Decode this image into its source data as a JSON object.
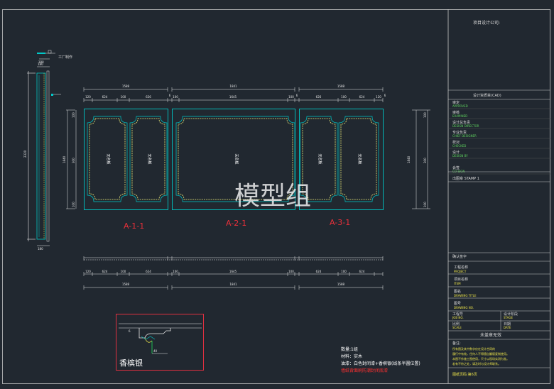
{
  "watermark": "模型组",
  "elevations": [
    {
      "label": "A-1-1",
      "panels": [
        "无名板",
        "无名板"
      ]
    },
    {
      "label": "A-2-1",
      "panels": [
        "无名板"
      ]
    },
    {
      "label": "A-3-1",
      "panels": [
        "无名板",
        "无名板"
      ]
    }
  ],
  "top_dims": {
    "totals": [
      "1588",
      "1841",
      "1588"
    ],
    "segs_a": [
      "120",
      "624",
      "100",
      "626"
    ],
    "seg_b_mid": "1645",
    "segs_c": [
      "626",
      "100",
      "624",
      "120"
    ],
    "mid_edges": [
      "100",
      "100"
    ],
    "end_edge": "6"
  },
  "bottom_dims": {
    "segs_a": [
      "120",
      "624",
      "100",
      "624"
    ],
    "seg_b_mid": "1645",
    "segs_c": [
      "624",
      "100",
      "624"
    ],
    "mid_edges": [
      "100",
      "100"
    ],
    "totals": [
      "1588",
      "1841",
      "1588"
    ]
  },
  "side_dims": {
    "height": "2320",
    "h1": "1840",
    "h2": "1840",
    "top": "180",
    "bottom": "180",
    "small": [
      "100",
      "300",
      "100"
    ]
  },
  "callout": "工厂制作",
  "profile": {
    "title": "香槟银",
    "dims": [
      "6",
      "40"
    ]
  },
  "notes": {
    "qty": "数量:1组",
    "material": "材料：实木",
    "finish": "油漆：白色封闭漆+香槟银(线条半圆位置)",
    "warning": "墙纸背面刷防潮封闭底漆"
  },
  "title_block": {
    "company": "项目设计公司:",
    "stamp_header": "设计资质章(CAD)",
    "roles": [
      {
        "cn": "审定",
        "en": "APPROVED"
      },
      {
        "cn": "审核",
        "en": "EXAMINED"
      },
      {
        "cn": "设计总负责",
        "en": "DESIGN DIRECTOR"
      },
      {
        "cn": "专业负责",
        "en": "CHIEF DESIGNER"
      },
      {
        "cn": "校对",
        "en": "CHECKED"
      },
      {
        "cn": "设计",
        "en": "DESIGN BY"
      },
      {
        "cn": "会签",
        "en": "CO-SIGN"
      }
    ],
    "stamp": "出图章 STAMP 1",
    "confirm": "确认签字",
    "project_name_cn": "工程名称",
    "project_name_en": "PROJECT",
    "item_name_cn": "项目名称",
    "item_name_en": "ITEM",
    "drawing_title_cn": "图名",
    "drawing_title_en": "DRAWING TITLE",
    "drawing_no_cn": "图号",
    "drawing_no_en": "DRAWING NO.",
    "job_no_cn": "工程号",
    "job_no_en": "JOB NO.",
    "stage_cn": "设计阶段",
    "stage_en": "STAGE",
    "scale_cn": "比例",
    "scale_en": "SCALE",
    "date_cn": "日期",
    "date_en": "DATE",
    "unstamped": "未盖章无效",
    "notes_title": "备注:",
    "notes_lines": [
      "所有图及其中数字仅在设计合同的",
      "履行中有效，任何人不得擅自翻版复制使用。",
      "本图不作施工图使用，尺寸以现场实测为准。",
      "若有不符之处，请及时与设计师联系。"
    ],
    "page": "图纸页码:第6页"
  },
  "colors": {
    "background": "#212830",
    "panel": "#00c8c8",
    "dashed": "#f0f07a",
    "label": "#e8303a",
    "frame_red": "#e03040"
  }
}
